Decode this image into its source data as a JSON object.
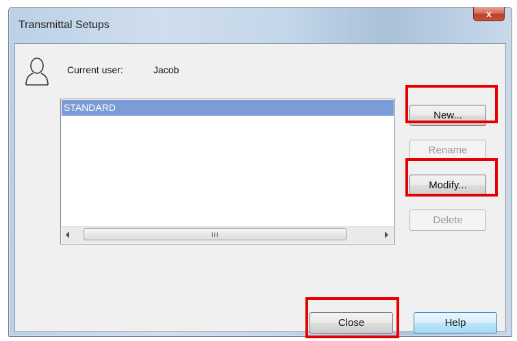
{
  "window": {
    "title": "Transmittal Setups",
    "close_glyph": "x"
  },
  "user": {
    "label": "Current user:",
    "name": "Jacob",
    "icon": "user-icon"
  },
  "list": {
    "items": [
      "STANDARD"
    ],
    "scroll_grip": "III"
  },
  "buttons": {
    "new": "New...",
    "rename": "Rename",
    "modify": "Modify...",
    "delete": "Delete",
    "close": "Close",
    "help": "Help"
  },
  "colors": {
    "highlight": "#e60000",
    "selection": "#7b9cd6",
    "help_accent": "#3c7fb1"
  }
}
